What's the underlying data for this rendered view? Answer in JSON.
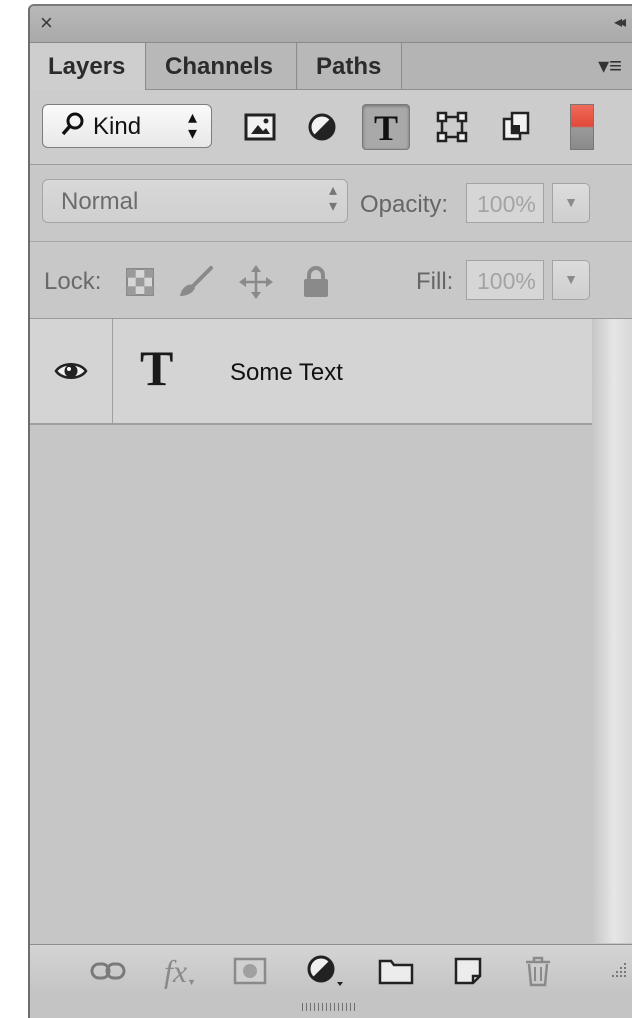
{
  "titlebar": {
    "close_glyph": "×",
    "collapse_glyph": "◂◂"
  },
  "tabs": [
    {
      "label": "Layers",
      "active": true
    },
    {
      "label": "Channels",
      "active": false
    },
    {
      "label": "Paths",
      "active": false
    }
  ],
  "filter": {
    "kind_label": "Kind",
    "kind_icon": "search-icon",
    "filter_icons": [
      "image-filter-icon",
      "adjustment-filter-icon",
      "type-filter-icon",
      "shape-filter-icon",
      "smart-object-filter-icon"
    ],
    "active_filter": "type-filter-icon",
    "toggle_color": "#e8503f"
  },
  "blend": {
    "mode": "Normal",
    "opacity_label": "Opacity:",
    "opacity_value": "100%"
  },
  "lock": {
    "label": "Lock:",
    "icons": [
      "lock-transparent-pixels-icon",
      "lock-image-pixels-icon",
      "lock-position-icon",
      "lock-all-icon"
    ],
    "fill_label": "Fill:",
    "fill_value": "100%"
  },
  "layers": [
    {
      "name": "Some Text",
      "thumb": "T",
      "visible": true
    }
  ],
  "bottom_icons": [
    "link-icon",
    "fx-icon",
    "add-mask-icon",
    "adjustment-layer-icon",
    "new-group-icon",
    "new-layer-icon",
    "trash-icon"
  ],
  "bottom_fx_text": "fx"
}
